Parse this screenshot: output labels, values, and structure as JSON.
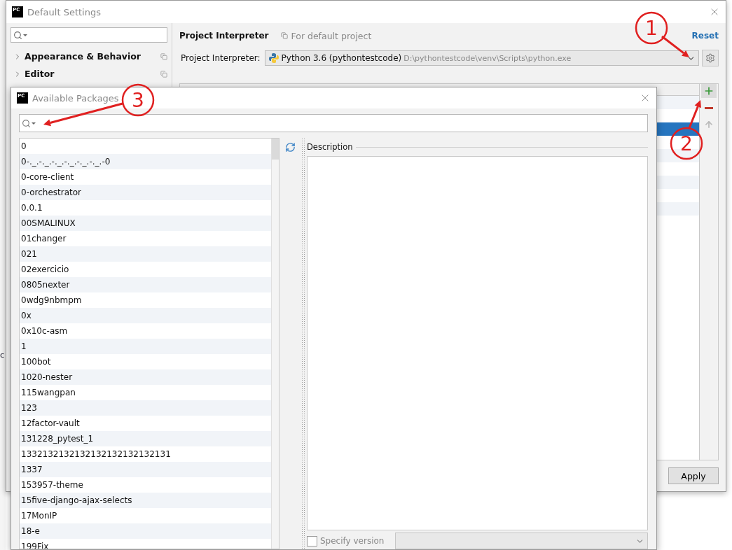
{
  "backdrop": {
    "fragment": "c"
  },
  "settings_window": {
    "app_icon": "PC",
    "title": "Default Settings",
    "sidebar": {
      "items": [
        {
          "label": "Appearance & Behavior",
          "expanded": false
        },
        {
          "label": "Editor",
          "expanded": false
        }
      ]
    },
    "header": {
      "title": "Project Interpreter",
      "scope": "For default project",
      "reset": "Reset"
    },
    "interpreter": {
      "label": "Project Interpreter:",
      "name": "Python 3.6 (pythontestcode)",
      "path": "D:\\pythontestcode\\venv\\Scripts\\python.exe"
    },
    "table": {
      "rows": [
        {
          "selected": false
        },
        {
          "selected": false
        },
        {
          "selected": true
        },
        {
          "selected": false
        },
        {
          "selected": false
        },
        {
          "selected": false
        },
        {
          "selected": false
        },
        {
          "selected": false
        },
        {
          "selected": false
        }
      ]
    },
    "toolbar": [
      {
        "kind": "add"
      },
      {
        "kind": "remove"
      },
      {
        "kind": "upgrade",
        "disabled": true
      }
    ],
    "apply": "Apply"
  },
  "packages_dialog": {
    "app_icon": "PC",
    "title": "Available Packages",
    "packages": [
      "0",
      "0-._.-._.-._.-._.-._.-._.-0",
      "0-core-client",
      "0-orchestrator",
      "0.0.1",
      "00SMALINUX",
      "01changer",
      "021",
      "02exercicio",
      "0805nexter",
      "0wdg9nbmpm",
      "0x",
      "0x10c-asm",
      "1",
      "100bot",
      "1020-nester",
      "115wangpan",
      "123",
      "12factor-vault",
      "131228_pytest_1",
      "1332132132132132132132132131",
      "1337",
      "153957-theme",
      "15five-django-ajax-selects",
      "17MonIP",
      "18-e",
      "199Fix"
    ],
    "description_label": "Description",
    "specify_version": {
      "label": "Specify version",
      "checked": false
    }
  },
  "annotations": [
    {
      "label": "1"
    },
    {
      "label": "2"
    },
    {
      "label": "3"
    }
  ]
}
